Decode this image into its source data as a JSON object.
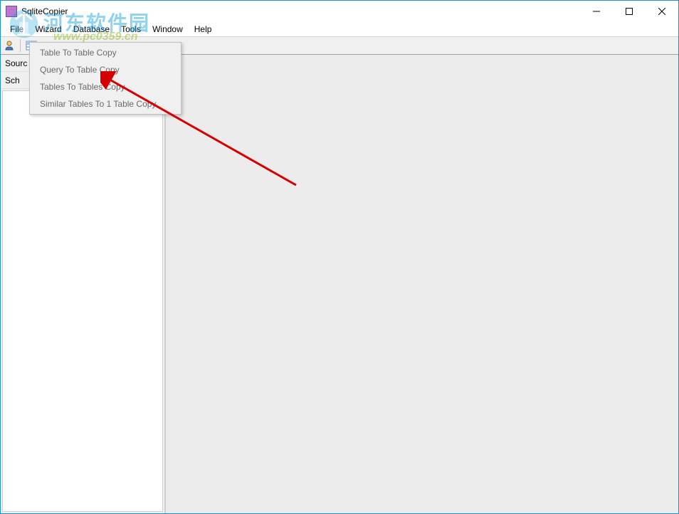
{
  "window": {
    "title": "SqliteCopier"
  },
  "menubar": {
    "items": [
      "File",
      "Wizard",
      "Database",
      "Tools",
      "Window",
      "Help"
    ]
  },
  "dropdown": {
    "items": [
      "Table To Table Copy",
      "Query To Table Copy",
      "Tables To Tables Copy",
      "Similar Tables To 1 Table Copy"
    ]
  },
  "leftpanel": {
    "source_label": "Sourc",
    "schema_label": "Sch"
  },
  "watermark": {
    "text": "河东软件园",
    "url": "www.pc0359.cn"
  }
}
